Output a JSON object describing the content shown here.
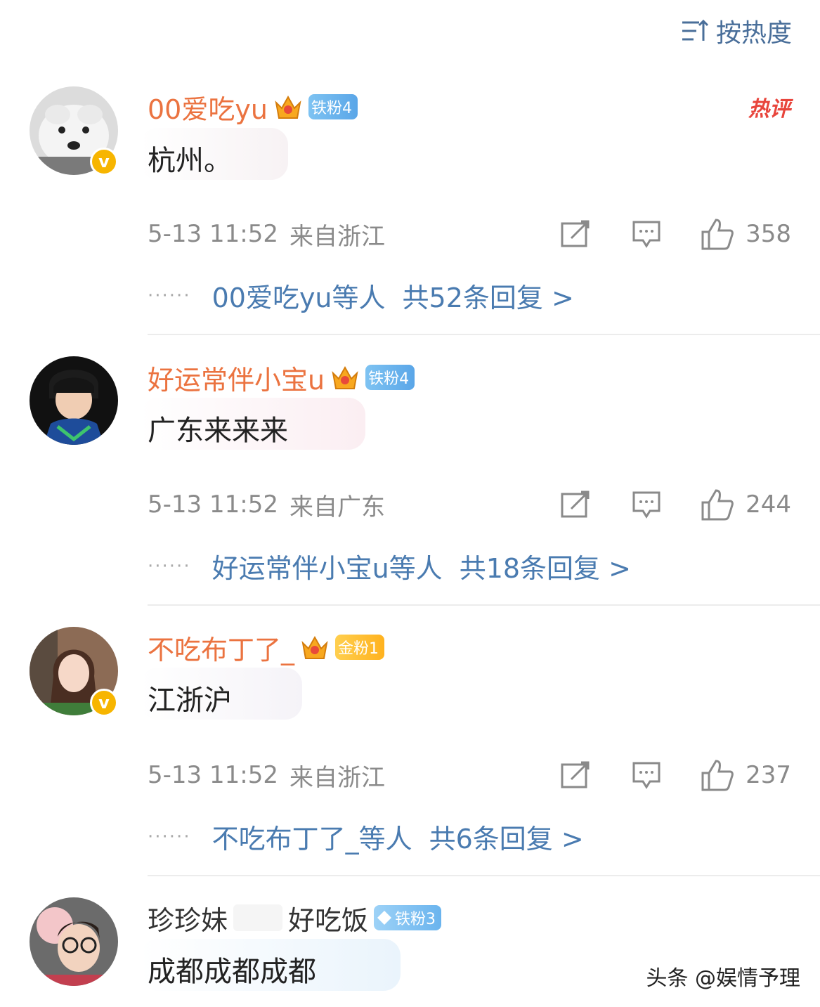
{
  "header": {
    "sort_label": "按热度",
    "sort_icon": "sort-icon"
  },
  "comments": [
    {
      "name": "00爱吃yu",
      "badge": "铁粉4",
      "crown_level": "6",
      "hot_label": "热评",
      "text": "杭州。",
      "time": "5-13 11:52",
      "location": "来自浙江",
      "likes": "358",
      "replies_names": "00爱吃yu等人",
      "replies_count": "共52条回复 >"
    },
    {
      "name": "好运常伴小宝u",
      "badge": "铁粉4",
      "crown_level": "3",
      "text": "广东来来来",
      "time": "5-13 11:52",
      "location": "来自广东",
      "likes": "244",
      "replies_names": "好运常伴小宝u等人",
      "replies_count": "共18条回复 >"
    },
    {
      "name": "不吃布丁了_",
      "badge": "金粉1",
      "crown_level": "4",
      "text": "江浙沪",
      "time": "5-13 11:52",
      "location": "来自浙江",
      "likes": "237",
      "replies_names": "不吃布丁了_等人",
      "replies_count": "共6条回复 >"
    },
    {
      "name": "珍珍妹",
      "name_tail": "好吃饭",
      "badge": "铁粉3",
      "text": "成都成都成都"
    }
  ],
  "watermark": "头条 @娱情予理",
  "colors": {
    "username": "#eb7340",
    "link": "#4a7bb0",
    "meta": "#8a8a8a",
    "verified": "#f7b500"
  }
}
